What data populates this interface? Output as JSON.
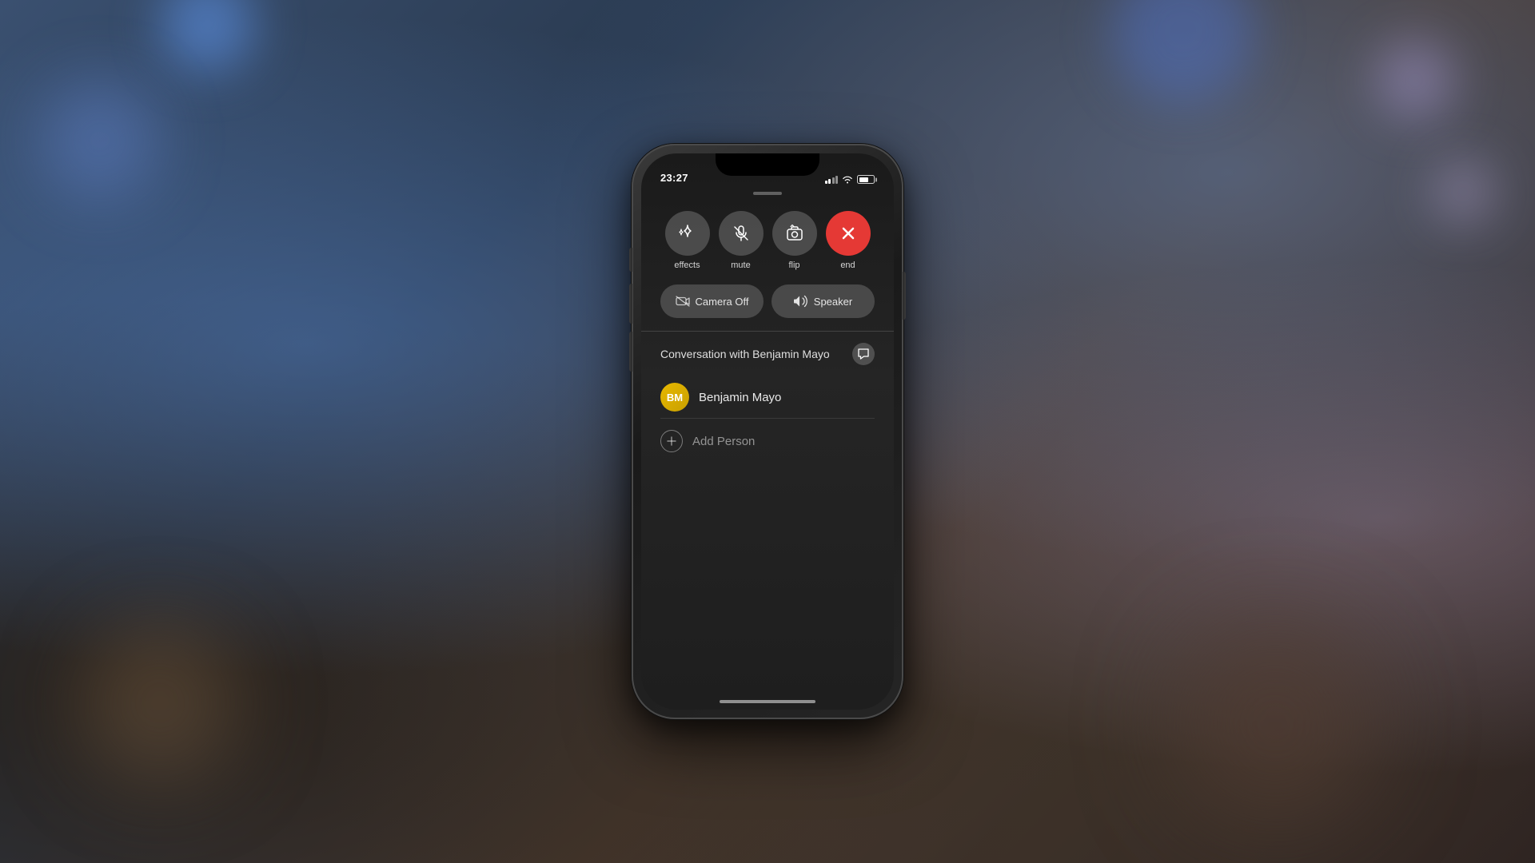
{
  "background": {
    "color": "#2a3a50"
  },
  "phone": {
    "status_bar": {
      "time": "23:27",
      "signal_label": "signal",
      "wifi_label": "wifi",
      "battery_label": "battery"
    },
    "call_controls": {
      "buttons": [
        {
          "id": "effects",
          "label": "effects",
          "icon": "star-icon",
          "type": "gray"
        },
        {
          "id": "mute",
          "label": "mute",
          "icon": "mic-off-icon",
          "type": "gray"
        },
        {
          "id": "flip",
          "label": "flip",
          "icon": "flip-camera-icon",
          "type": "gray"
        },
        {
          "id": "end",
          "label": "end",
          "icon": "x-icon",
          "type": "red"
        }
      ],
      "camera_off_label": "Camera Off",
      "speaker_label": "Speaker"
    },
    "conversation": {
      "title": "Conversation with Benjamin Mayo",
      "message_icon": "message-icon",
      "contact": {
        "initials": "BM",
        "name": "Benjamin Mayo"
      },
      "add_person_label": "Add Person"
    },
    "home_indicator": true
  }
}
